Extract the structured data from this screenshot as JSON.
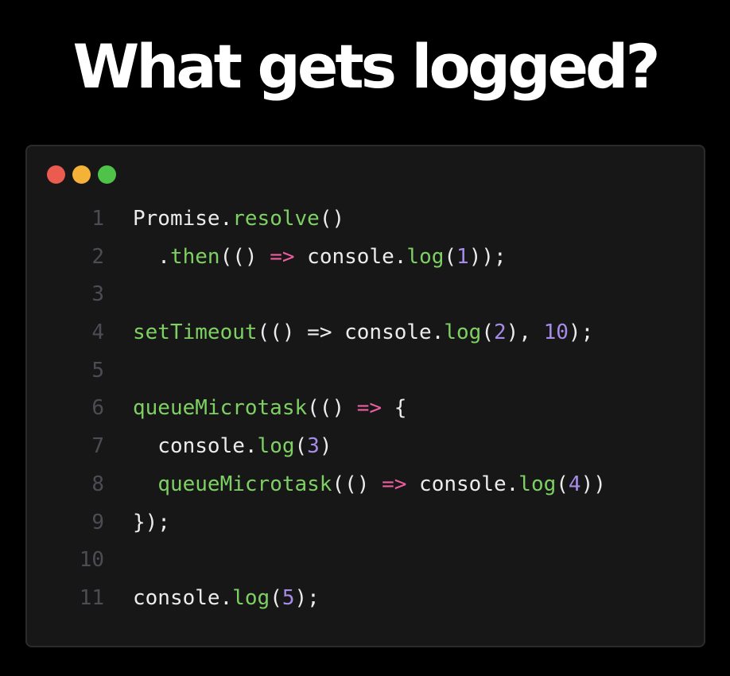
{
  "title": "What gets logged?",
  "window": {
    "traffic_lights": [
      {
        "name": "close",
        "color": "#ec5b4f"
      },
      {
        "name": "minimize",
        "color": "#f4b337"
      },
      {
        "name": "maximize",
        "color": "#4fc24a"
      }
    ]
  },
  "colors": {
    "background": "#000000",
    "panel": "#171718",
    "panel_border": "#2a2b2d",
    "text": "#ececec",
    "function": "#7ed063",
    "keyword_arrow": "#ec5ea0",
    "number": "#a68ce8",
    "line_number": "#4b4d52"
  },
  "code": {
    "lines": [
      {
        "number": "1",
        "tokens": [
          {
            "t": "Promise.",
            "c": "text"
          },
          {
            "t": "resolve",
            "c": "function"
          },
          {
            "t": "()",
            "c": "text"
          }
        ]
      },
      {
        "number": "2",
        "tokens": [
          {
            "t": "  .",
            "c": "text"
          },
          {
            "t": "then",
            "c": "function"
          },
          {
            "t": "(() ",
            "c": "text"
          },
          {
            "t": "=>",
            "c": "keyword_arrow"
          },
          {
            "t": " console.",
            "c": "text"
          },
          {
            "t": "log",
            "c": "function"
          },
          {
            "t": "(",
            "c": "text"
          },
          {
            "t": "1",
            "c": "number"
          },
          {
            "t": "));",
            "c": "text"
          }
        ]
      },
      {
        "number": "3",
        "tokens": []
      },
      {
        "number": "4",
        "tokens": [
          {
            "t": "setTimeout",
            "c": "function"
          },
          {
            "t": "(() => console.",
            "c": "text"
          },
          {
            "t": "log",
            "c": "function"
          },
          {
            "t": "(",
            "c": "text"
          },
          {
            "t": "2",
            "c": "number"
          },
          {
            "t": "), ",
            "c": "text"
          },
          {
            "t": "10",
            "c": "number"
          },
          {
            "t": ");",
            "c": "text"
          }
        ]
      },
      {
        "number": "5",
        "tokens": []
      },
      {
        "number": "6",
        "tokens": [
          {
            "t": "queueMicrotask",
            "c": "function"
          },
          {
            "t": "(() ",
            "c": "text"
          },
          {
            "t": "=>",
            "c": "keyword_arrow"
          },
          {
            "t": " {",
            "c": "text"
          }
        ]
      },
      {
        "number": "7",
        "tokens": [
          {
            "t": "  console.",
            "c": "text"
          },
          {
            "t": "log",
            "c": "function"
          },
          {
            "t": "(",
            "c": "text"
          },
          {
            "t": "3",
            "c": "number"
          },
          {
            "t": ")",
            "c": "text"
          }
        ]
      },
      {
        "number": "8",
        "tokens": [
          {
            "t": "  ",
            "c": "text"
          },
          {
            "t": "queueMicrotask",
            "c": "function"
          },
          {
            "t": "(() ",
            "c": "text"
          },
          {
            "t": "=>",
            "c": "keyword_arrow"
          },
          {
            "t": " console.",
            "c": "text"
          },
          {
            "t": "log",
            "c": "function"
          },
          {
            "t": "(",
            "c": "text"
          },
          {
            "t": "4",
            "c": "number"
          },
          {
            "t": "))",
            "c": "text"
          }
        ]
      },
      {
        "number": "9",
        "tokens": [
          {
            "t": "});",
            "c": "text"
          }
        ]
      },
      {
        "number": "10",
        "tokens": []
      },
      {
        "number": "11",
        "tokens": [
          {
            "t": "console.",
            "c": "text"
          },
          {
            "t": "log",
            "c": "function"
          },
          {
            "t": "(",
            "c": "text"
          },
          {
            "t": "5",
            "c": "number"
          },
          {
            "t": ");",
            "c": "text"
          }
        ]
      }
    ]
  }
}
